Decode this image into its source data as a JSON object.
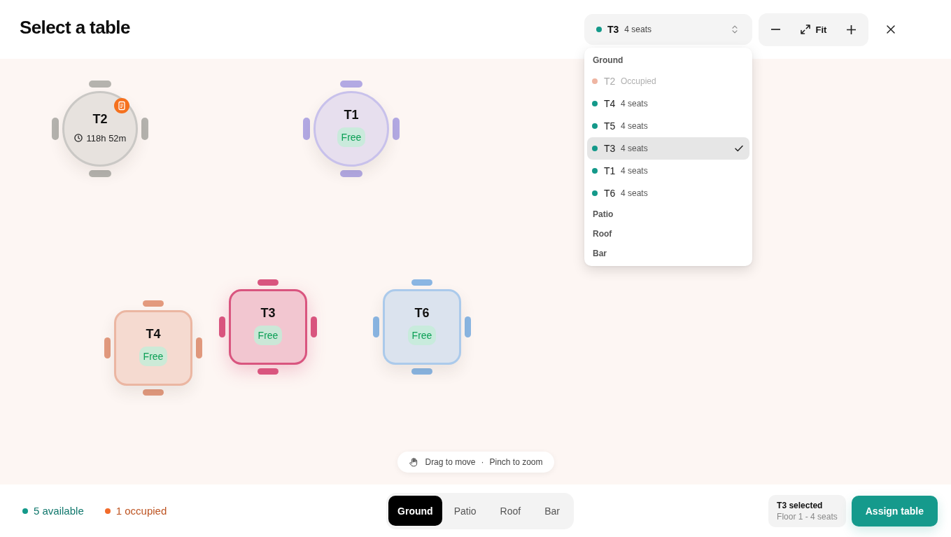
{
  "title": "Select a table",
  "select": {
    "label": "T3",
    "detail": "4 seats",
    "color": "#14998a",
    "expanded": true
  },
  "dropdown": {
    "groups": [
      {
        "label": "Ground",
        "items": [
          {
            "label": "T2",
            "detail": "Occupied",
            "color": "#efb5a2",
            "disabled": true,
            "selected": false
          },
          {
            "label": "T4",
            "detail": "4 seats",
            "color": "#14998a",
            "disabled": false,
            "selected": false
          },
          {
            "label": "T5",
            "detail": "4 seats",
            "color": "#14998a",
            "disabled": false,
            "selected": false
          },
          {
            "label": "T3",
            "detail": "4 seats",
            "color": "#14998a",
            "disabled": false,
            "selected": true
          },
          {
            "label": "T1",
            "detail": "4 seats",
            "color": "#14998a",
            "disabled": false,
            "selected": false
          },
          {
            "label": "T6",
            "detail": "4 seats",
            "color": "#14998a",
            "disabled": false,
            "selected": false
          }
        ]
      },
      {
        "label": "Patio"
      },
      {
        "label": "Roof"
      },
      {
        "label": "Bar"
      }
    ]
  },
  "zoom": {
    "fit_label": "Fit"
  },
  "tables": [
    {
      "label": "T2",
      "kind": "round",
      "color": "#b5b3ae",
      "selected": false,
      "occupied": true,
      "timer": "118h 52m",
      "note": true
    },
    {
      "label": "T1",
      "kind": "round",
      "color": "#b3a9e3",
      "selected": false,
      "occupied": false,
      "badge": "Free",
      "note": false
    },
    {
      "label": "T4",
      "kind": "square",
      "color": "#e39a7e",
      "selected": false,
      "occupied": false,
      "badge": "Free",
      "note": false
    },
    {
      "label": "T3",
      "kind": "square",
      "color": "#d9557f",
      "selected": true,
      "occupied": false,
      "badge": "Free",
      "note": false
    },
    {
      "label": "T6",
      "kind": "square",
      "color": "#8ab6e3",
      "selected": false,
      "occupied": false,
      "badge": "Free",
      "note": false
    }
  ],
  "hint": {
    "parts": [
      "Drag to move",
      "Pinch to zoom"
    ],
    "separator": "·"
  },
  "legend": [
    {
      "label": "5 available",
      "color": "#14998a"
    },
    {
      "label": "1 occupied",
      "color": "#f26b2a"
    }
  ],
  "floor_tabs": [
    {
      "label": "Ground",
      "selected": true
    },
    {
      "label": "Patio",
      "selected": false
    },
    {
      "label": "Roof",
      "selected": false
    },
    {
      "label": "Bar",
      "selected": false
    }
  ],
  "selection": {
    "title": "T3 selected",
    "detail": "Floor 1 - 4 seats"
  },
  "assign_button": "Assign table"
}
